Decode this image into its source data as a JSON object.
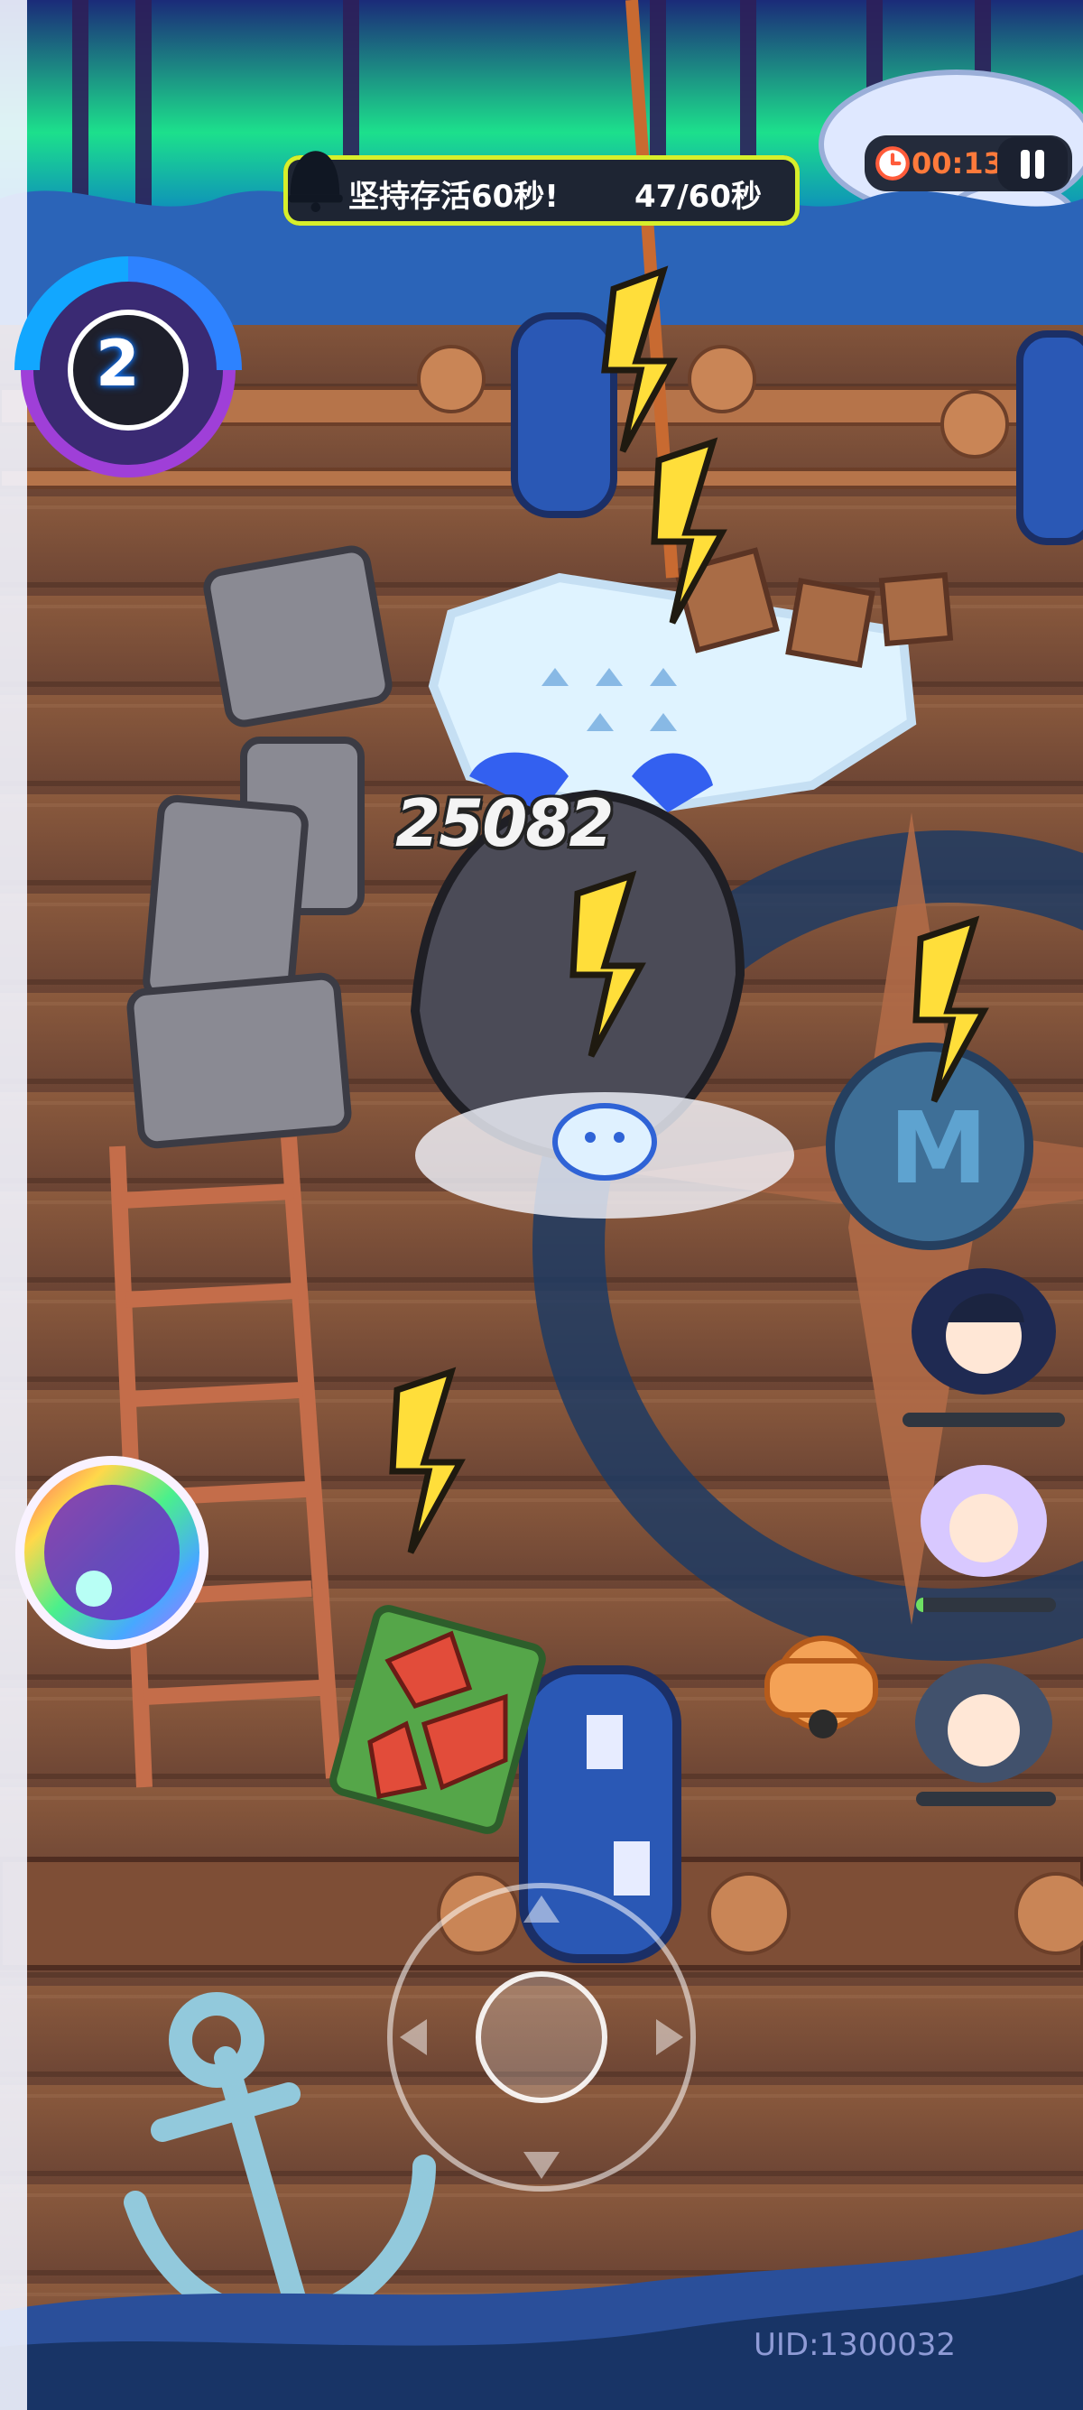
{
  "hud": {
    "objective_text": "坚持存活60秒!",
    "objective_progress": "47/60秒",
    "timer": "00:13",
    "level": "2"
  },
  "combat": {
    "damage_number": "25082"
  },
  "footer": {
    "uid": "UID:1300032"
  },
  "party": [
    {
      "name": "member-1",
      "hp": 0
    },
    {
      "name": "member-2",
      "hp": 0.05
    },
    {
      "name": "member-3",
      "hp": 0
    }
  ],
  "colors": {
    "objective_border": "#d7ef2b",
    "timer_text": "#ff7a3b",
    "uid_text": "#8f9bd6"
  },
  "icons": {
    "bell": "bell-icon",
    "timer": "timer-icon",
    "pause": "pause-icon",
    "skill": "skill-icon",
    "joystick": "joystick-icon",
    "lightning": "lightning-icon"
  }
}
